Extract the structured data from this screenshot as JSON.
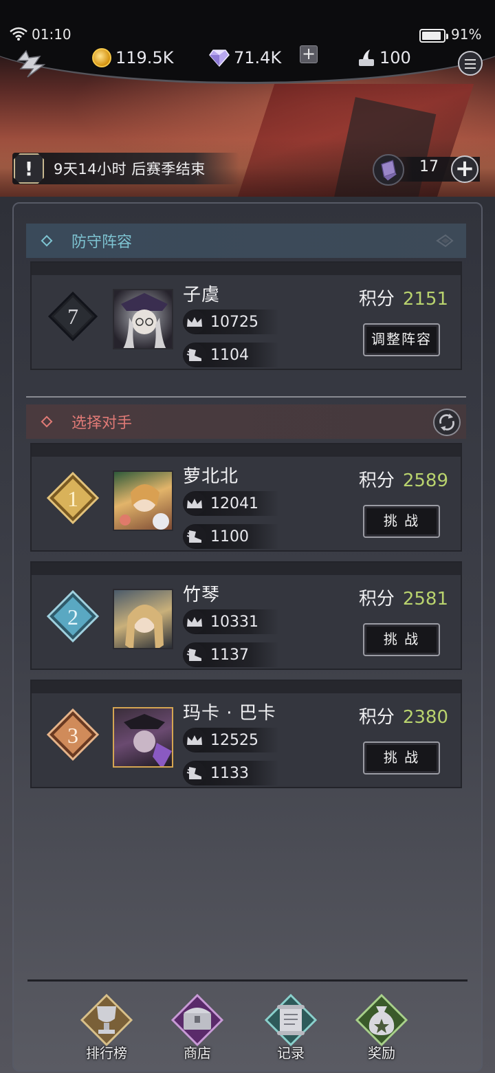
{
  "status_bar": {
    "time": "01:10",
    "battery": "91%"
  },
  "currencies": {
    "gold": "119.5K",
    "gems": "71.4K",
    "tickets": "100"
  },
  "season": {
    "text": "9天14小时 后赛季结束"
  },
  "scrolls": {
    "count": "17"
  },
  "defense": {
    "header": "防守阵容",
    "rank": "7",
    "name": "子虞",
    "power": "10725",
    "speed": "1104",
    "score_label": "积分",
    "score": "2151",
    "button": "调整阵容"
  },
  "opponents": {
    "header": "选择对手",
    "list": [
      {
        "rank": "1",
        "name": "萝北北",
        "power": "12041",
        "speed": "1100",
        "score_label": "积分",
        "score": "2589",
        "button": "挑 战"
      },
      {
        "rank": "2",
        "name": "竹琴",
        "power": "10331",
        "speed": "1137",
        "score_label": "积分",
        "score": "2581",
        "button": "挑 战"
      },
      {
        "rank": "3",
        "name": "玛卡 · 巴卡",
        "power": "12525",
        "speed": "1133",
        "score_label": "积分",
        "score": "2380",
        "button": "挑 战"
      }
    ]
  },
  "nav": [
    {
      "label": "排行榜",
      "icon": "trophy-icon"
    },
    {
      "label": "商店",
      "icon": "treasure-chest-icon"
    },
    {
      "label": "记录",
      "icon": "scroll-record-icon"
    },
    {
      "label": "奖励",
      "icon": "money-bag-icon"
    }
  ],
  "colors": {
    "score_green": "#b9d36e",
    "defense_cyan": "#7ec4d2",
    "opponent_red": "#e07a76",
    "rank1_gold": "#d9b25a",
    "rank2_blue": "#5aa8c2",
    "rank3_bronze": "#d08b5a"
  }
}
